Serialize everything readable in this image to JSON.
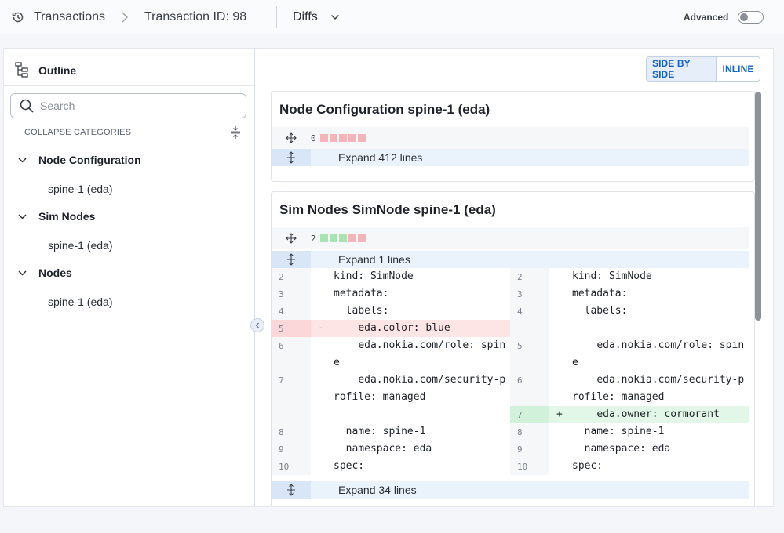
{
  "header": {
    "breadcrumb_root": "Transactions",
    "breadcrumb_current": "Transaction ID: 98",
    "view_selector": "Diffs",
    "advanced_label": "Advanced",
    "advanced_enabled": false
  },
  "sidebar": {
    "title": "Outline",
    "search_placeholder": "Search",
    "collapse_label": "COLLAPSE CATEGORIES",
    "categories": [
      {
        "label": "Node Configuration",
        "items": [
          "spine-1 (eda)"
        ]
      },
      {
        "label": "Sim Nodes",
        "items": [
          "spine-1 (eda)"
        ]
      },
      {
        "label": "Nodes",
        "items": [
          "spine-1 (eda)"
        ]
      }
    ]
  },
  "main": {
    "view_modes": {
      "side_by_side": "SIDE BY SIDE",
      "inline": "INLINE",
      "active": "side_by_side"
    },
    "diffs": [
      {
        "title": "Node Configuration spine-1 (eda)",
        "change_count": "0",
        "expand_label": "Expand 412 lines"
      },
      {
        "title": "Sim Nodes SimNode spine-1 (eda)",
        "change_count": "2",
        "expand_top_label": "Expand 1 lines",
        "expand_bottom_label": "Expand 34 lines",
        "lines": [
          {
            "left_no": "2",
            "left": "kind: SimNode",
            "right_no": "2",
            "right": "kind: SimNode"
          },
          {
            "left_no": "3",
            "left": "metadata:",
            "right_no": "3",
            "right": "metadata:"
          },
          {
            "left_no": "4",
            "left": "  labels:",
            "right_no": "4",
            "right": "  labels:"
          },
          {
            "left_no": "5",
            "left_marker": "-",
            "left": "    eda.color: blue",
            "right_no": "",
            "right": ""
          },
          {
            "left_no": "6",
            "left": "    eda.nokia.com/role: spine",
            "right_no": "5",
            "right": "    eda.nokia.com/role: spine"
          },
          {
            "left_no": "7",
            "left": "    eda.nokia.com/security-profile: managed",
            "right_no": "6",
            "right": "    eda.nokia.com/security-profile: managed"
          },
          {
            "left_no": "",
            "left": "",
            "right_no": "7",
            "right_marker": "+",
            "right": "    eda.owner: cormorant"
          },
          {
            "left_no": "8",
            "left": "  name: spine-1",
            "right_no": "8",
            "right": "  name: spine-1"
          },
          {
            "left_no": "9",
            "left": "  namespace: eda",
            "right_no": "9",
            "right": "  namespace: eda"
          },
          {
            "left_no": "10",
            "left": "spec:",
            "right_no": "10",
            "right": "spec:"
          }
        ]
      }
    ]
  },
  "colors": {
    "accent": "#1464c8",
    "deleted": "#fde4e5",
    "added": "#e3f7e8",
    "expand": "#eaf2fc"
  }
}
